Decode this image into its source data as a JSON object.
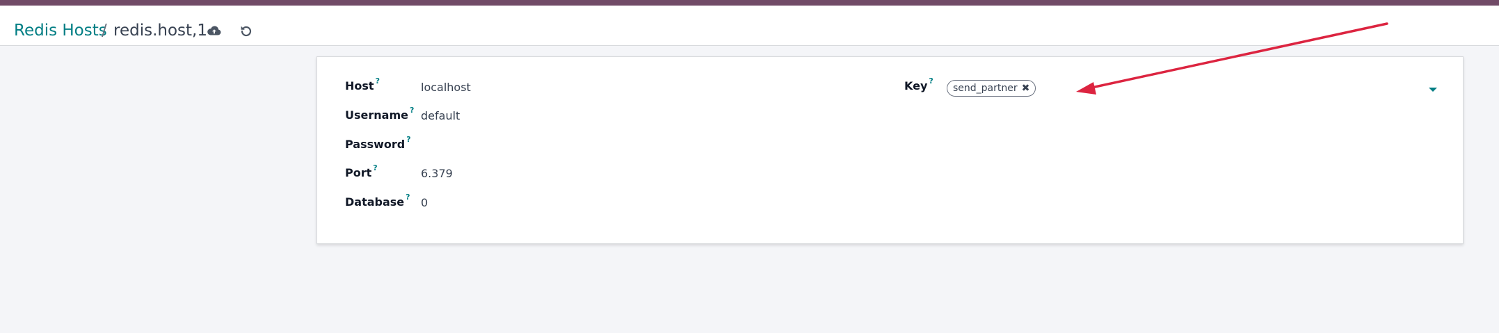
{
  "breadcrumb": {
    "parent": "Redis Hosts",
    "separator": "/",
    "current": "redis.host,1"
  },
  "toolbar": {
    "save_icon": "cloud-upload-icon",
    "discard_icon": "undo-icon"
  },
  "form": {
    "fields_left": [
      {
        "label": "Host",
        "help": "?",
        "value": "localhost"
      },
      {
        "label": "Username",
        "help": "?",
        "value": "default"
      },
      {
        "label": "Password",
        "help": "?",
        "value": ""
      },
      {
        "label": "Port",
        "help": "?",
        "value": "6.379"
      },
      {
        "label": "Database",
        "help": "?",
        "value": "0"
      }
    ],
    "key_field": {
      "label": "Key",
      "help": "?",
      "tags": [
        {
          "text": "send_partner",
          "remove_icon": "close-icon"
        }
      ],
      "dropdown_icon": "caret-down-icon"
    }
  },
  "annotation": {
    "type": "red-arrow",
    "color": "#dc2440"
  },
  "colors": {
    "brand_top": "#714b67",
    "link": "#017e84"
  }
}
